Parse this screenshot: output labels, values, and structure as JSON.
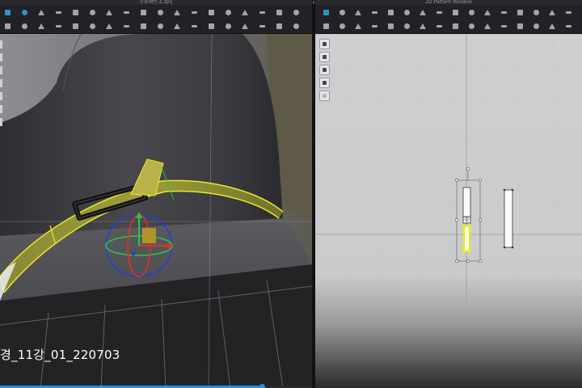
{
  "window": {
    "left_title": "무료패턴-2.zprj",
    "right_title": "2D Pattern Window"
  },
  "toolbar_3d": {
    "row1_icons": [
      "select-mesh-icon",
      "transform-icon",
      "fold-icon",
      "flatten-icon",
      "garment-icon",
      "rotate-left-icon",
      "rotate-right-icon",
      "undo-icon",
      "redo-icon",
      "pin-icon",
      "tack-icon",
      "fabric-icon",
      "shirt-icon",
      "shirt-alt-icon",
      "pants-icon",
      "hanger-icon",
      "measure-icon",
      "settings-icon"
    ],
    "row2_icons": [
      "arrangement-icon",
      "point-icon",
      "line-icon",
      "edit-icon",
      "zip-icon",
      "button-icon",
      "buttonhole-icon",
      "trim-icon",
      "puckering-icon",
      "topstitch-icon",
      "piping-icon",
      "graphic-icon",
      "texture-icon",
      "avatar-icon",
      "pose-icon",
      "light-icon",
      "camera-icon",
      "render-icon"
    ]
  },
  "toolbar_2d": {
    "row1_icons": [
      "transform-pattern-icon",
      "edit-point-icon",
      "edit-curvature-icon",
      "add-point-icon",
      "polygon-icon",
      "rectangle-icon",
      "circle-icon",
      "internal-polygon-icon",
      "dart-icon",
      "segment-sewing-icon",
      "free-sewing-icon",
      "fold-arrangement-icon",
      "trace-icon",
      "symmetry-icon",
      "notch-icon",
      "grid-icon"
    ],
    "row2_icons": [
      "edit-sewing-icon",
      "check-sewing-icon",
      "m-n-sewing-icon",
      "tuck-icon",
      "gather-icon",
      "elastic-icon",
      "seam-allowance-icon",
      "grainline-icon",
      "graphic-2d-icon",
      "pleat-icon",
      "zipper-2d-icon",
      "binding-icon",
      "strap-icon",
      "puckering-2d-icon",
      "annotation-icon",
      "more-icon"
    ]
  },
  "side_tools": [
    "edit-pattern-icon",
    "select-mesh-2d-icon",
    "color-picker-icon",
    "rectangle-select-icon",
    "disabled-tool-icon"
  ],
  "video": {
    "caption": "경_11강_01_220703",
    "progress_fraction": 0.84
  },
  "colors": {
    "selection_yellow": "#e8e82a",
    "gizmo_red": "#e83020",
    "gizmo_green": "#28c840",
    "gizmo_blue": "#2040e0",
    "progress_blue": "#2e8fdc"
  }
}
